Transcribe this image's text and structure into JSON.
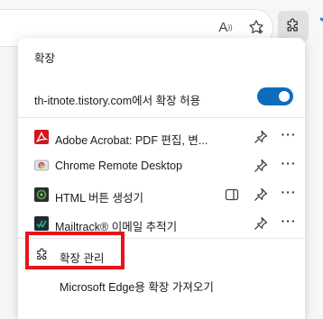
{
  "toolbar": {
    "read_aloud_label": "A",
    "icons": [
      "read-aloud-icon",
      "favorite-star-icon",
      "extensions-puzzle-icon",
      "copilot-icon"
    ]
  },
  "panel": {
    "title": "확장",
    "site_access": "th-itnote.tistory.com에서 확장 허용",
    "site_access_enabled": true,
    "extensions": [
      {
        "name": "Adobe Acrobat: PDF 편집, 변...",
        "icon": "adobe-acrobat-icon"
      },
      {
        "name": "Chrome Remote Desktop",
        "icon": "chrome-remote-desktop-icon"
      },
      {
        "name": "HTML 버튼 생성기",
        "icon": "html-button-generator-icon"
      },
      {
        "name": "Mailtrack® 이메일 추적기",
        "icon": "mailtrack-icon"
      }
    ],
    "more_label": "···",
    "manage_label": "확장 관리",
    "get_label": "Microsoft Edge용 확장 가져오기"
  },
  "colors": {
    "accent": "#0f6cbd",
    "highlight": "#e8141b",
    "adobe": "#d0191e",
    "mailtrack": "#1aa879"
  }
}
